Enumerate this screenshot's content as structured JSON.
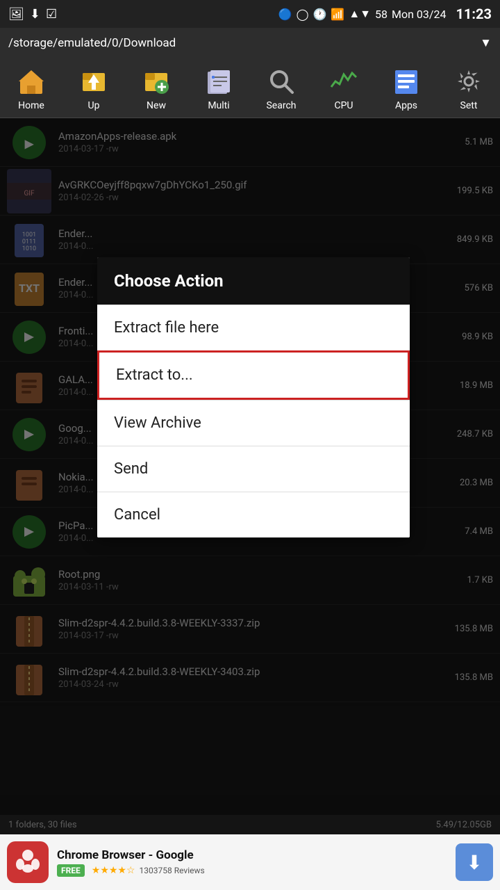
{
  "statusBar": {
    "icons": [
      "image",
      "download",
      "checkbox"
    ],
    "bluetooth": "⬡",
    "signal": "📶",
    "time_indicator": "🕐",
    "wifi": "WiFi",
    "battery": "58",
    "date": "Mon 03/24",
    "time": "11:23"
  },
  "pathBar": {
    "path": "/storage/emulated/0/Download",
    "arrow": "▼"
  },
  "toolbar": {
    "items": [
      {
        "id": "home",
        "label": "Home",
        "icon": "🏠"
      },
      {
        "id": "up",
        "label": "Up",
        "icon": "📁"
      },
      {
        "id": "new",
        "label": "New",
        "icon": "📂"
      },
      {
        "id": "multi",
        "label": "Multi",
        "icon": "📋"
      },
      {
        "id": "search",
        "label": "Search",
        "icon": "🔍"
      },
      {
        "id": "cpu",
        "label": "CPU",
        "icon": "📊"
      },
      {
        "id": "apps",
        "label": "Apps",
        "icon": "💾"
      },
      {
        "id": "settings",
        "label": "Sett",
        "icon": "🔧"
      }
    ]
  },
  "files": [
    {
      "name": "AmazonApps-release.apk",
      "date": "2014-03-17 -rw",
      "size": "5.1 MB",
      "icon": "apk",
      "thumb": "🟢"
    },
    {
      "name": "AvGRKCOeyjff8pqxw7gDhYCKo1_250.gif",
      "date": "2014-02-26 -rw",
      "size": "199.5 KB",
      "icon": "gif",
      "thumb": "img"
    },
    {
      "name": "Ender...",
      "date": "2014-0...",
      "size": "849.9 KB",
      "icon": "bin",
      "thumb": "bin"
    },
    {
      "name": "Ender...",
      "date": "2014-0...",
      "size": "576 KB",
      "icon": "txt",
      "thumb": "txt"
    },
    {
      "name": "Fronti...",
      "date": "2014-0...",
      "size": "98.9 KB",
      "icon": "apk",
      "thumb": "apk"
    },
    {
      "name": "GALA...",
      "date": "2014-0...",
      "size": "18.9 MB",
      "icon": "archive",
      "thumb": "arc"
    },
    {
      "name": "Goog...",
      "date": "2014-0...",
      "size": "248.7 KB",
      "icon": "apk",
      "thumb": "apk"
    },
    {
      "name": "Nokia...",
      "date": "2014-0...",
      "size": "20.3 MB",
      "icon": "archive",
      "thumb": "arc"
    },
    {
      "name": "PicPa...",
      "date": "2014-0...",
      "size": "7.4 MB",
      "icon": "apk",
      "thumb": "apk"
    },
    {
      "name": "Root.png",
      "date": "2014-03-11 -rw",
      "size": "1.7 KB",
      "icon": "android",
      "thumb": "🤖"
    },
    {
      "name": "Slim-d2spr-4.4.2.build.3.8-WEEKLY-3337.zip",
      "date": "2014-03-17 -rw",
      "size": "135.8 MB",
      "icon": "zip",
      "thumb": "zip"
    },
    {
      "name": "Slim-d2spr-4.4.2.build.3.8-WEEKLY-3403.zip",
      "date": "2014-03-24 -rw",
      "size": "135.8 MB",
      "icon": "zip",
      "thumb": "zip"
    }
  ],
  "contextMenu": {
    "title": "Choose Action",
    "items": [
      {
        "id": "extract-here",
        "label": "Extract file here",
        "highlighted": false
      },
      {
        "id": "extract-to",
        "label": "Extract to...",
        "highlighted": true
      },
      {
        "id": "view-archive",
        "label": "View Archive",
        "highlighted": false
      },
      {
        "id": "send",
        "label": "Send",
        "highlighted": false
      },
      {
        "id": "cancel",
        "label": "Cancel",
        "highlighted": false
      }
    ]
  },
  "bottomStatus": {
    "left": "1 folders, 30 files",
    "right": "5.49/12.05GB"
  },
  "adBar": {
    "icon": "🌐",
    "title": "Chrome Browser - Google",
    "free_label": "FREE",
    "stars": "★★★★☆",
    "reviews": "1303758 Reviews",
    "download_icon": "⬇"
  }
}
